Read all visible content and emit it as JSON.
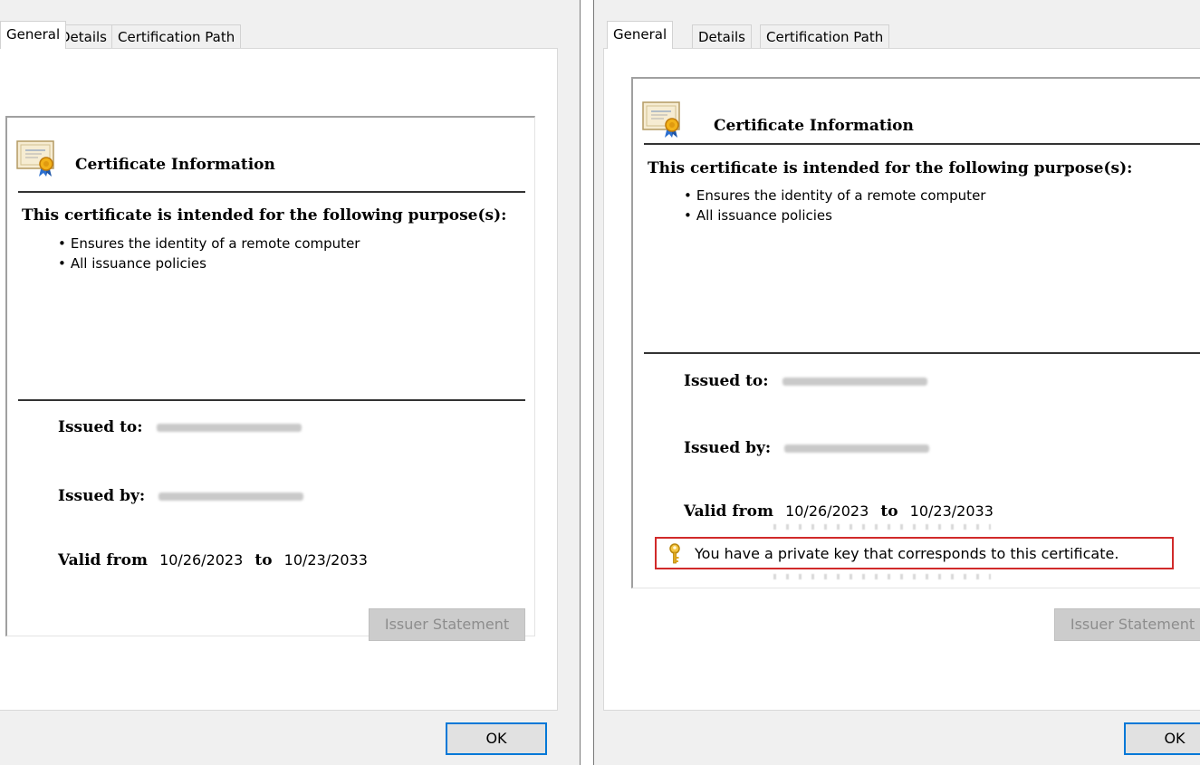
{
  "tabs": [
    "General",
    "Details",
    "Certification Path"
  ],
  "certificate": {
    "title": "Certificate Information",
    "purpose_heading": "This certificate is intended for the following purpose(s):",
    "purposes": [
      "Ensures the identity of a remote computer",
      "All issuance policies"
    ],
    "issued_to_label": "Issued to:",
    "issued_by_label": "Issued by:",
    "valid_from_label": "Valid from",
    "valid_from": "10/26/2023",
    "to_label": "to",
    "valid_to": "10/23/2033",
    "private_key_note": "You have a private key that corresponds to this certificate."
  },
  "buttons": {
    "issuer_statement": "Issuer Statement",
    "ok": "OK"
  },
  "colors": {
    "highlight_border": "#d12a2a",
    "default_button_border": "#0078d7",
    "panel_bg": "#f0f0f0"
  },
  "icons": [
    "certificate-icon",
    "key-icon"
  ]
}
